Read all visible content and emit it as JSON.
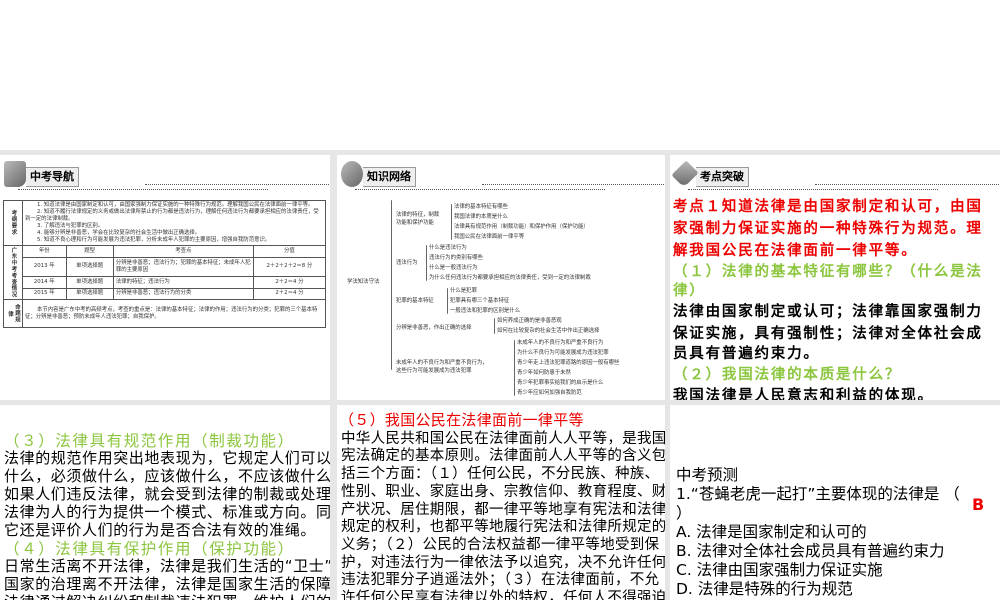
{
  "panel1": {
    "header": "中考导航",
    "req_label": "考纲要求",
    "requirements": [
      "1. 知道法律是由国家制定和认可，由国家强制力保证实施的一种特殊行为规范。理解我国公民在法律面前一律平等。",
      "2. 知道不履行法律规定的义务或做出法律所禁止的行为都是违法行为，理解任何违法行为都要承担相应的法律责任，受到一定的法律制裁。",
      "3. 了解违法与犯罪的区别。",
      "4. 能够分辨是非善恶，学会在比较复杂的社会生活中做出正确选择。",
      "5. 知道不良心理和行为可能发展为违法犯罪，分析未成年人犯罪的主要原因，增强自我防范意识。"
    ],
    "exam_label": "广东中考考查情况",
    "columns": [
      "年份",
      "题型",
      "考查点",
      "分值"
    ],
    "rows": [
      [
        "2013 年",
        "单项选择题",
        "分辨是非善恶；违法行为；犯罪的基本特征；未成年人犯罪的主要原因",
        "2＋2＋2＋2＝8 分"
      ],
      [
        "2014 年",
        "单项选择题",
        "法律的特征；违法行为",
        "2＋2＝4 分"
      ],
      [
        "2015 年",
        "单项选择题",
        "分辨是非善恶；违法行为的分类",
        "2＋2＝4 分"
      ]
    ],
    "rule_label": "命题规律",
    "rule_text": "本节内容是广东中考的高频考点，考查的重点是：法律的基本特征；法律的作用；违法行为的分类；犯罪的三个基本特征；分辨是非善恶；预防未成年人违法犯罪；自我保护。"
  },
  "panel2": {
    "header": "知识网络",
    "root": "学法知法守法",
    "branches": [
      {
        "label": [
          "法律的特征，制裁",
          "功能和保护功能"
        ],
        "items": [
          "法律的基本特征有哪些",
          "我国法律的本质是什么",
          "法律具有规范作用（制裁功能）和保护作用（保护功能）",
          "我国公民在法律面前一律平等"
        ]
      },
      {
        "label": [
          "违法行为"
        ],
        "items": [
          "什么是违法行为",
          "违法行为的类别有哪些",
          "什么是一般违法行为",
          "为什么任何违法行为都要承担相应的法律责任，受到一定的法律制裁"
        ]
      },
      {
        "label": [
          "犯罪的基本特征"
        ],
        "items": [
          "什么是犯罪",
          "犯罪具有哪三个基本特征",
          "一般违法和犯罪的区别是什么"
        ]
      },
      {
        "label": [
          "分辨是非善恶，作出正确的选择"
        ],
        "items": [
          "如何养成正确的是非善恶观",
          "如何在比较复杂的社会生活中作出正确选择"
        ]
      },
      {
        "label": [
          "未成年人的不良行为和严重不良行为，",
          "这些行为可能发展成为违法犯罪"
        ],
        "items": [
          "未成年人的不良行为和严重不良行为",
          "为什么不良行为可能发展成为违法犯罪",
          "青少年走上违法犯罪道路的原因一般有哪些",
          "青少年如何防患于未然",
          "青少年犯罪事实给我们的启示是什么",
          "青少年应如何加强自我防范"
        ]
      }
    ]
  },
  "panel3": {
    "header": "考点突破",
    "red_lines": [
      "考点１知道法律是由国家制定和认可，由国",
      "家强制力保证实施的一种特殊行为规范。理",
      "解我国公民在法律面前一律平等。"
    ],
    "q1_lines": [
      "（１）法律的基本特征有哪些？（什么是法",
      "律）"
    ],
    "a1_lines": [
      "法律由国家制定或认可；法律靠国家强制力",
      "保证实施，具有强制性；法律对全体社会成",
      "员具有普遍约束力。"
    ],
    "q2": "（２）我国法律的本质是什么？",
    "a2": "我国法律是人民意志和利益的体现。"
  },
  "panel4": {
    "h3": "（３）法律具有规范作用（制裁功能）",
    "p3": [
      "法律的规范作用突出地表现为，它规定人们可以做",
      "什么，必须做什么，应该做什么，不应该做什么。",
      "如果人们违反法律，就会受到法律的制裁或处理。",
      "法律为人的行为提供一个模式、标准或方向。同时，",
      "它还是评价人们的行为是否合法有效的准绳。"
    ],
    "h4": "（４）法律具有保护作用（保护功能）",
    "p4": [
      "日常生活离不开法律，法律是我们生活的“卫士”。",
      "国家的治理离不开法律，法律是国家生活的保障。",
      "法律通过解决纠纷和制裁违法犯罪，维护人们的合"
    ]
  },
  "panel5": {
    "h5": "（５）我国公民在法律面前一律平等",
    "p5": [
      "中华人民共和国公民在法律面前人人平等，是我国",
      "宪法确定的基本原则。法律面前人人平等的含义包",
      "括三个方面：（１）任何公民，不分民族、种族、",
      "性别、职业、家庭出身、宗教信仰、教育程度、财",
      "产状况、居住期限，都一律平等地享有宪法和法律",
      "规定的权利，也都平等地履行宪法和法律所规定的",
      "义务；（２）公民的合法权益都一律平等地受到保",
      "护，对违法行为一律依法予以追究，决不允许任何",
      "违法犯罪分子逍遥法外；（３）在法律面前，不允",
      "许任何公民享有法律以外的特权，任何人不得强迫"
    ]
  },
  "panel6": {
    "title": "中考预测",
    "question": "1.“苍蝇老虎一起打”主要体现的法律是 （",
    "close": "）",
    "answer": "B",
    "options": [
      "A. 法律是国家制定和认可的",
      "B. 法律对全体社会成员具有普遍约束力",
      "C. 法律由国家强制力保证实施",
      "D. 法律是特殊的行为规范"
    ]
  },
  "colors": {
    "red": "#e00000",
    "green": "#8cc63f"
  }
}
